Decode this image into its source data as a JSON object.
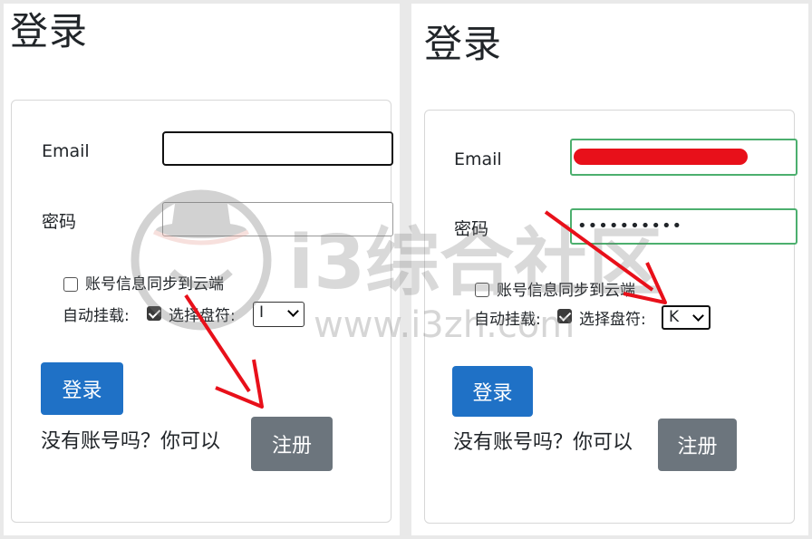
{
  "left": {
    "page_title": "登录",
    "email_label": "Email",
    "email_value": "",
    "password_label": "密码",
    "sync_label": "账号信息同步到云端",
    "sync_checked": false,
    "automount_label": "自动挂载:",
    "automount_checked": true,
    "drive_label": "选择盘符:",
    "drive_value": "I",
    "login_button": "登录",
    "no_account_text": "没有账号吗？你可以",
    "register_button": "注册"
  },
  "right": {
    "page_title": "登录",
    "email_label": "Email",
    "email_value": "redacted",
    "password_label": "密码",
    "password_mask": "••••••••••",
    "sync_label": "账号信息同步到云端",
    "sync_checked": false,
    "automount_label": "自动挂载:",
    "automount_checked": true,
    "drive_label": "选择盘符:",
    "drive_value": "K",
    "login_button": "登录",
    "no_account_text": "没有账号吗？你可以",
    "register_button": "注册"
  },
  "watermark": {
    "text_cn": "i3综合社区",
    "text_url": "www.i3zh.com"
  },
  "colors": {
    "primary_button": "#1f71c6",
    "secondary_button": "#6c757d",
    "annotation_arrow": "#e8101a",
    "valid_border": "#4caf6e"
  },
  "icons": [
    "checkbox",
    "chevron-down-icon",
    "red-arrow-annotation",
    "watermark-logo-icon"
  ]
}
